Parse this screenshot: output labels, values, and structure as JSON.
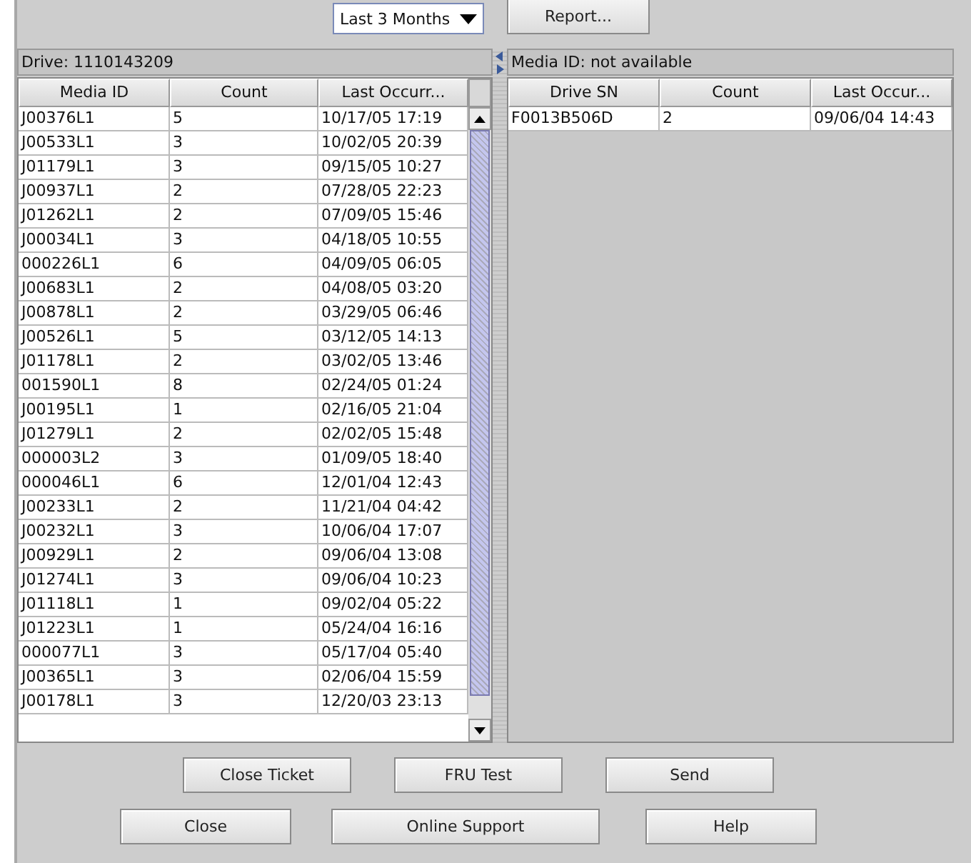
{
  "toolbar": {
    "period_dropdown": {
      "value": "Last 3 Months"
    },
    "report_button": "Report..."
  },
  "drive_panel": {
    "title": "Drive: 1110143209",
    "columns": [
      "Media ID",
      "Count",
      "Last Occurr..."
    ],
    "rows": [
      [
        "J00376L1",
        "5",
        "10/17/05 17:19"
      ],
      [
        "J00533L1",
        "3",
        "10/02/05 20:39"
      ],
      [
        "J01179L1",
        "3",
        "09/15/05 10:27"
      ],
      [
        "J00937L1",
        "2",
        "07/28/05 22:23"
      ],
      [
        "J01262L1",
        "2",
        "07/09/05 15:46"
      ],
      [
        "J00034L1",
        "3",
        "04/18/05 10:55"
      ],
      [
        "000226L1",
        "6",
        "04/09/05 06:05"
      ],
      [
        "J00683L1",
        "2",
        "04/08/05 03:20"
      ],
      [
        "J00878L1",
        "2",
        "03/29/05 06:46"
      ],
      [
        "J00526L1",
        "5",
        "03/12/05 14:13"
      ],
      [
        "J01178L1",
        "2",
        "03/02/05 13:46"
      ],
      [
        "001590L1",
        "8",
        "02/24/05 01:24"
      ],
      [
        "J00195L1",
        "1",
        "02/16/05 21:04"
      ],
      [
        "J01279L1",
        "2",
        "02/02/05 15:48"
      ],
      [
        "000003L2",
        "3",
        "01/09/05 18:40"
      ],
      [
        "000046L1",
        "6",
        "12/01/04 12:43"
      ],
      [
        "J00233L1",
        "2",
        "11/21/04 04:42"
      ],
      [
        "J00232L1",
        "3",
        "10/06/04 17:07"
      ],
      [
        "J00929L1",
        "2",
        "09/06/04 13:08"
      ],
      [
        "J01274L1",
        "3",
        "09/06/04 10:23"
      ],
      [
        "J01118L1",
        "1",
        "09/02/04 05:22"
      ],
      [
        "J01223L1",
        "1",
        "05/24/04 16:16"
      ],
      [
        "000077L1",
        "3",
        "05/17/04 05:40"
      ],
      [
        "J00365L1",
        "3",
        "02/06/04 15:59"
      ],
      [
        "J00178L1",
        "3",
        "12/20/03 23:13"
      ]
    ]
  },
  "media_panel": {
    "title": "Media ID: not available",
    "columns": [
      "Drive SN",
      "Count",
      "Last Occur..."
    ],
    "rows": [
      [
        "F0013B506D",
        "2",
        "09/06/04 14:43"
      ]
    ]
  },
  "action_buttons": [
    "Close Ticket",
    "FRU Test",
    "Send"
  ],
  "dialog_buttons": [
    "Close",
    "Online Support",
    "Help"
  ]
}
